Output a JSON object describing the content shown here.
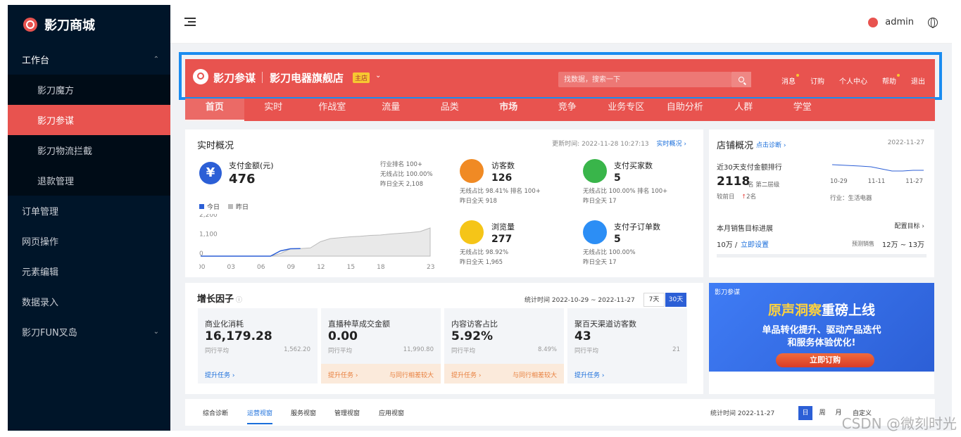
{
  "sidebar": {
    "brand": "影刀商城",
    "items": [
      {
        "label": "工作台",
        "open": true
      },
      {
        "label": "影刀魔方",
        "sub": true
      },
      {
        "label": "影刀参谋",
        "sub": true,
        "active": true
      },
      {
        "label": "影刀物流拦截",
        "sub": true
      },
      {
        "label": "退款管理",
        "sub": true
      },
      {
        "label": "订单管理"
      },
      {
        "label": "网页操作"
      },
      {
        "label": "元素编辑"
      },
      {
        "label": "数据录入"
      },
      {
        "label": "影刀FUN叉岛",
        "expandable": true
      }
    ]
  },
  "header": {
    "user": "admin"
  },
  "banner": {
    "title": "影刀参谋",
    "store": "影刀电器旗舰店",
    "badge": "主店",
    "search_placeholder": "找数据，搜索一下",
    "links": [
      "消息",
      "订购",
      "个人中心",
      "帮助",
      "退出"
    ]
  },
  "tabs": [
    "首页",
    "实时",
    "作战室",
    "流量",
    "品类",
    "市场",
    "竞争",
    "业务专区",
    "自助分析",
    "人群",
    "学堂"
  ],
  "overview": {
    "title": "实时概况",
    "update": "更新时间: 2022-11-28 10:27:13",
    "link": "实时概况 ›",
    "pay_label": "支付金额(元)",
    "pay_value": "476",
    "side": [
      "行业排名  100+",
      "无线占比  100.00%",
      "昨日全天  2,108"
    ],
    "legend_today": "今日",
    "legend_yesterday": "昨日",
    "metrics": [
      {
        "label": "访客数",
        "value": "126",
        "s1": "无线占比  98.41%   排名  100+",
        "s2": "昨日全天  918"
      },
      {
        "label": "支付买家数",
        "value": "5",
        "s1": "无线占比  100.00%   排名  100+",
        "s2": "昨日全天  17"
      },
      {
        "label": "浏览量",
        "value": "277",
        "s1": "无线占比  98.92%",
        "s2": "昨日全天  1,965"
      },
      {
        "label": "支付子订单数",
        "value": "5",
        "s1": "无线占比  100.00%",
        "s2": "昨日全天  17"
      }
    ]
  },
  "chart_data": {
    "type": "area",
    "x": [
      "00",
      "03",
      "06",
      "09",
      "12",
      "15",
      "18",
      "23"
    ],
    "yticks": [
      "2,200",
      "1,100",
      "0"
    ],
    "ylim": [
      0,
      2200
    ],
    "series": [
      {
        "name": "今日",
        "color": "#2c5fd6",
        "values": [
          0,
          0,
          0,
          0,
          0,
          0,
          0,
          0,
          300,
          420,
          430
        ]
      },
      {
        "name": "昨日",
        "color": "#bbbbbb",
        "values": [
          0,
          0,
          0,
          0,
          0,
          0,
          0,
          0,
          150,
          420,
          430,
          470,
          820,
          1000,
          1050,
          1100,
          1130,
          1180,
          1200,
          1260,
          1300,
          1340,
          1400,
          1600
        ]
      }
    ]
  },
  "shop": {
    "title": "店铺概况",
    "diag": "点击诊断 ›",
    "date": "2022-11-27",
    "rank_title": "近30天支付金额排行",
    "rank": "2118",
    "rank_unit": "名  第二层级",
    "compare": "较前日",
    "compare_val": "2名",
    "dates": [
      "10-29",
      "11-11",
      "11-27"
    ],
    "industry": "行业：生活电器",
    "goal_title": "本月销售目标进展",
    "goal_link": "配置目标 ›",
    "goal_value": "10万 /",
    "goal_set": "立即设置",
    "forecast_label": "预测销售",
    "forecast": "12万 ~ 13万"
  },
  "growth": {
    "title": "增长因子",
    "period": "统计时间 2022-10-29 ~ 2022-11-27",
    "btn7": "7天",
    "btn30": "30天",
    "boxes": [
      {
        "label": "商业化消耗",
        "value": "16,179.28",
        "avg": "同行平均",
        "avgv": "1,562.20",
        "foot": "提升任务 ›",
        "warm": false,
        "right": ""
      },
      {
        "label": "直播种草成交金额",
        "value": "0.00",
        "avg": "同行平均",
        "avgv": "11,990.80",
        "foot": "提升任务 ›",
        "warm": true,
        "right": "与同行相差较大"
      },
      {
        "label": "内容访客占比",
        "value": "5.92%",
        "avg": "同行平均",
        "avgv": "8.49%",
        "foot": "提升任务 ›",
        "warm": true,
        "right": "与同行相差较大"
      },
      {
        "label": "聚百天渠道访客数",
        "value": "43",
        "avg": "同行平均",
        "avgv": "21",
        "foot": "提升任务 ›",
        "warm": false,
        "right": ""
      }
    ]
  },
  "ad": {
    "brand": "影刀参谋",
    "title_a": "原声洞察",
    "title_b": "重磅上线",
    "line1": "单品转化提升、驱动产品迭代",
    "line2": "和服务体验优化!",
    "button": "立即订购"
  },
  "bottom": {
    "tabs": [
      "综合诊断",
      "运营视窗",
      "服务视窗",
      "管理视窗",
      "应用视窗"
    ],
    "date": "统计时间 2022-11-27",
    "periods": [
      "日",
      "周",
      "月"
    ],
    "custom": "自定义"
  },
  "watermark": "CSDN @微刻时光"
}
